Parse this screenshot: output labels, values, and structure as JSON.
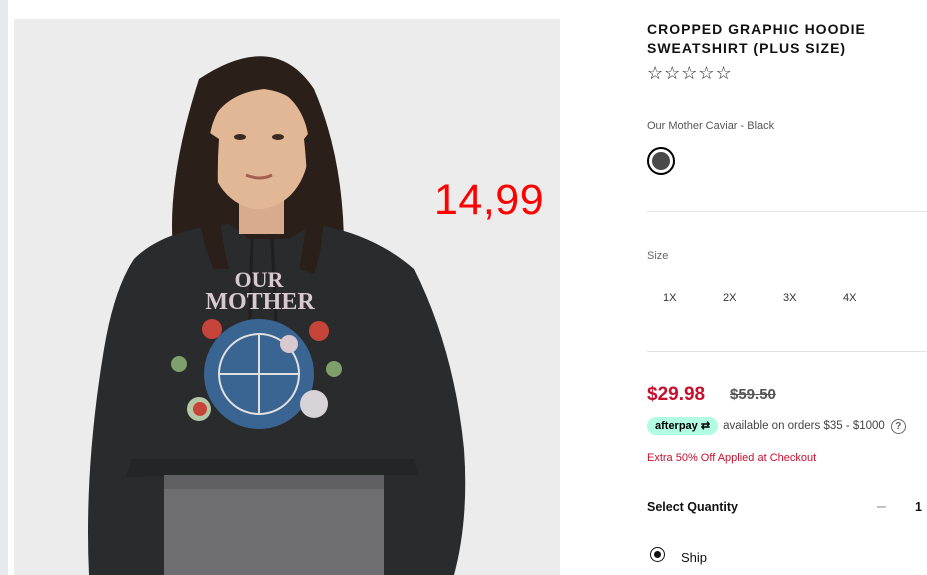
{
  "overlay": {
    "price_tag": "14,99"
  },
  "product": {
    "title": "CROPPED GRAPHIC HOODIE SWEATSHIRT (PLUS SIZE)",
    "rating_stars": "☆☆☆☆☆",
    "rating_value": 0,
    "color_name": "Our Mother Caviar - Black",
    "swatch_color": "#4a4a4a",
    "image_print_text": "OUR MOTHER"
  },
  "size": {
    "label": "Size",
    "options": [
      "1X",
      "2X",
      "3X",
      "4X"
    ]
  },
  "pricing": {
    "sale_price": "$29.98",
    "original_price": "$59.50",
    "afterpay_badge": "afterpay",
    "afterpay_text": "available on orders $35 - $1000",
    "help_icon": "?",
    "promo_text": "Extra 50% Off Applied at Checkout",
    "sale_color": "#c8102e"
  },
  "quantity": {
    "label": "Select Quantity",
    "minus": "–",
    "value": "1"
  },
  "delivery": {
    "ship_label": "Ship"
  }
}
